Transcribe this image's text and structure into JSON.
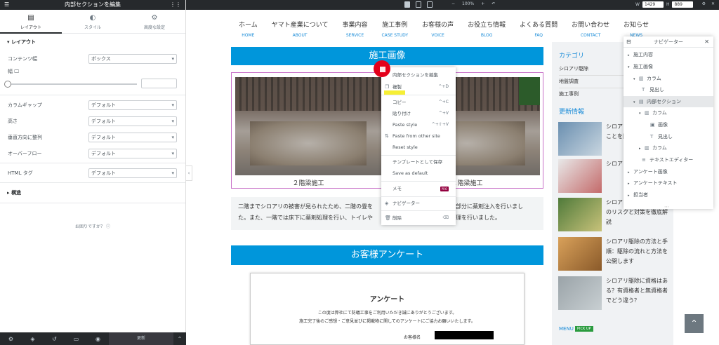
{
  "panel": {
    "title": "内部セクションを編集",
    "tabs": [
      {
        "label": "レイアウト",
        "icon": "layout-icon"
      },
      {
        "label": "スタイル",
        "icon": "brush-icon"
      },
      {
        "label": "高度な設定",
        "icon": "gear-icon"
      }
    ],
    "section_layout": "レイアウト",
    "content_width_label": "コンテンツ幅",
    "content_width_value": "ボックス",
    "width_label": "幅",
    "column_gap_label": "カラムギャップ",
    "column_gap_value": "デフォルト",
    "height_label": "高さ",
    "height_value": "デフォルト",
    "vertical_align_label": "垂直方向に整列",
    "vertical_align_value": "デフォルト",
    "overflow_label": "オーバーフロー",
    "overflow_value": "デフォルト",
    "html_tag_label": "HTML タグ",
    "html_tag_value": "デフォルト",
    "section_structure": "構造",
    "help": "お困りですか？",
    "update_label": "更新"
  },
  "toolbar": {
    "zoom": "100%",
    "w_label": "W",
    "w_value": "1429",
    "h_label": "H",
    "h_value": "889"
  },
  "nav": [
    {
      "jp": "ホーム",
      "en": "HOME"
    },
    {
      "jp": "ヤマト産業について",
      "en": "ABOUT"
    },
    {
      "jp": "事業内容",
      "en": "SERVICE"
    },
    {
      "jp": "施工事例",
      "en": "CASE STUDY"
    },
    {
      "jp": "お客様の声",
      "en": "VOICE"
    },
    {
      "jp": "お役立ち情報",
      "en": "BLOG"
    },
    {
      "jp": "よくある質問",
      "en": "FAQ"
    },
    {
      "jp": "お問い合わせ",
      "en": "CONTACT"
    },
    {
      "jp": "お知らせ",
      "en": "NEWS"
    }
  ],
  "main": {
    "heading_seko": "施工画像",
    "captions": [
      "２階梁施工",
      "２階梁施工"
    ],
    "body_text_1": "二階までシロアリの被害が見られたため、二階の畳を",
    "body_text_1b": "害部分に薬剤注入を行いまし",
    "body_text_2": "た。また、一階では床下に薬剤処理を行い、トイレや",
    "body_text_2b": "処理を行いました。",
    "heading_survey": "お客様アンケート",
    "survey_title": "アンケート",
    "survey_line1": "この度は弊社にて防蟻工事をご利用いただき誠にありがとうございます。",
    "survey_line2": "施工完了後のご感想・ご意見並びに掲載物に関してのアンケートにご協力お願いいたします。",
    "survey_name_label": "お客様名"
  },
  "sidebar": {
    "category_heading": "カテゴリ",
    "categories": [
      "シロアリ駆除",
      "地盤調査",
      "施工事例"
    ],
    "news_heading": "更新情報",
    "posts": [
      "シロアリは家の中に入ることを防ぐ方法",
      "シロアリは夏とはできる",
      "シロアリを放置した場合のリスクと対策を徹底解説",
      "シロアリ駆除の方法と手順：駆除の流れと方法を公開します",
      "シロアリ駆除に資格はある？有資格者と無資格者でどう違う？"
    ],
    "menu_label": "MENU",
    "pickup_label": "PICK UP"
  },
  "navigator": {
    "title": "ナビゲーター",
    "items": [
      {
        "label": "施工内容",
        "icon": "section-icon",
        "arrow": "▸"
      },
      {
        "label": "施工画像",
        "icon": "section-icon",
        "arrow": "▾"
      },
      {
        "label": "カラム",
        "icon": "column-icon",
        "arrow": "▾"
      },
      {
        "label": "見出し",
        "icon": "heading-icon",
        "arrow": ""
      },
      {
        "label": "内部セクション",
        "icon": "inner-section-icon",
        "arrow": "▾"
      },
      {
        "label": "カラム",
        "icon": "column-icon",
        "arrow": "▾"
      },
      {
        "label": "画像",
        "icon": "image-icon",
        "arrow": ""
      },
      {
        "label": "見出し",
        "icon": "heading-icon",
        "arrow": ""
      },
      {
        "label": "カラム",
        "icon": "column-icon",
        "arrow": "▸"
      },
      {
        "label": "テキストエディター",
        "icon": "text-editor-icon",
        "arrow": ""
      },
      {
        "label": "アンケート画像",
        "icon": "section-icon",
        "arrow": "▸"
      },
      {
        "label": "アンケートテキスト",
        "icon": "section-icon",
        "arrow": "▸"
      },
      {
        "label": "担当者",
        "icon": "section-icon",
        "arrow": "▸"
      }
    ]
  },
  "context_menu": {
    "edit_label": "内部セクションを編集",
    "duplicate_label": "複製",
    "duplicate_shortcut": "^+D",
    "copy_label": "コピー",
    "copy_shortcut": "^+C",
    "paste_label": "貼り付け",
    "paste_shortcut": "^+V",
    "paste_style_label": "Paste style",
    "paste_style_shortcut": "^+⇧+V",
    "paste_other_label": "Paste from other site",
    "reset_style_label": "Reset style",
    "save_template_label": "テンプレートとして保存",
    "save_default_label": "Save as default",
    "memo_label": "メモ",
    "pro_badge": "PRO",
    "navigator_label": "ナビゲーター",
    "delete_label": "削除"
  }
}
